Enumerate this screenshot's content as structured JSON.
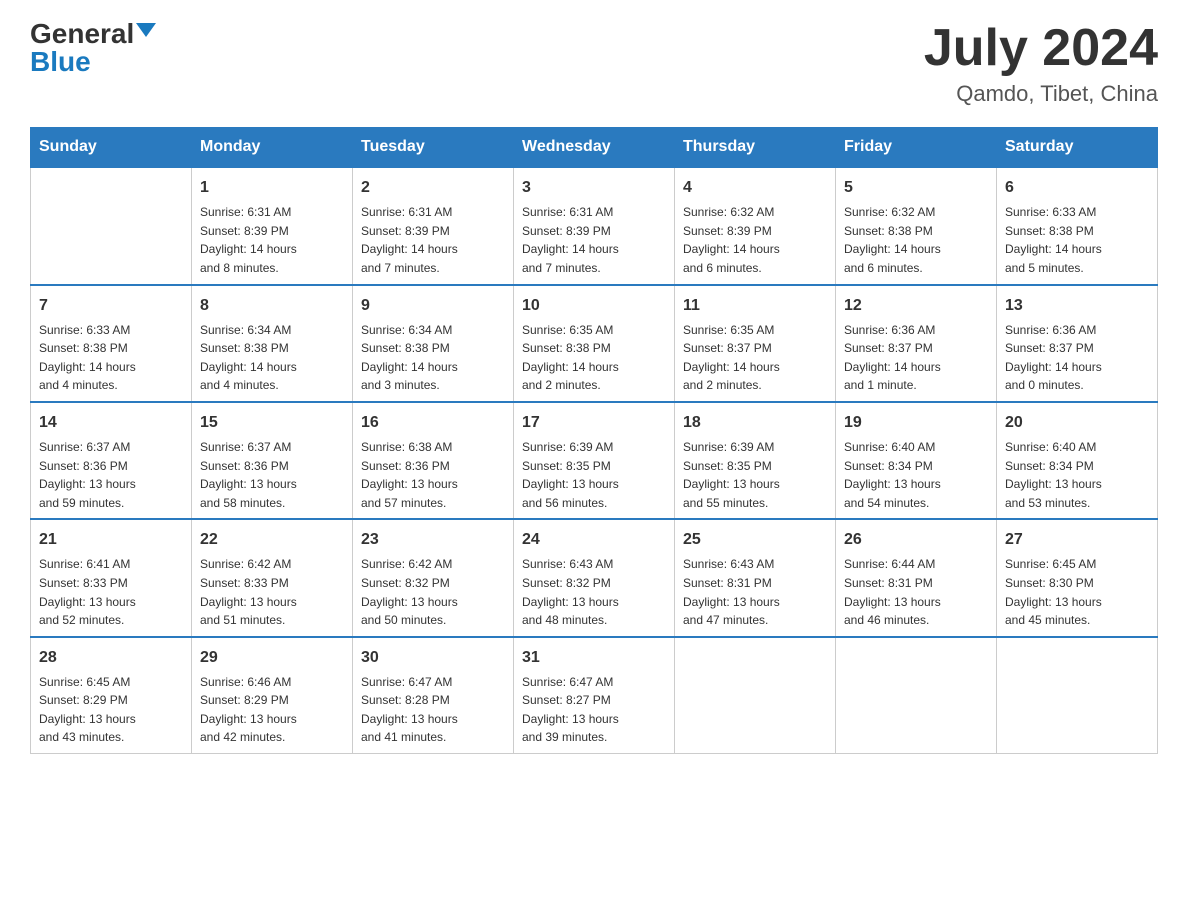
{
  "header": {
    "logo_general": "General",
    "logo_blue": "Blue",
    "month_year": "July 2024",
    "location": "Qamdo, Tibet, China"
  },
  "days_of_week": [
    "Sunday",
    "Monday",
    "Tuesday",
    "Wednesday",
    "Thursday",
    "Friday",
    "Saturday"
  ],
  "weeks": [
    [
      {
        "day": "",
        "info": ""
      },
      {
        "day": "1",
        "info": "Sunrise: 6:31 AM\nSunset: 8:39 PM\nDaylight: 14 hours\nand 8 minutes."
      },
      {
        "day": "2",
        "info": "Sunrise: 6:31 AM\nSunset: 8:39 PM\nDaylight: 14 hours\nand 7 minutes."
      },
      {
        "day": "3",
        "info": "Sunrise: 6:31 AM\nSunset: 8:39 PM\nDaylight: 14 hours\nand 7 minutes."
      },
      {
        "day": "4",
        "info": "Sunrise: 6:32 AM\nSunset: 8:39 PM\nDaylight: 14 hours\nand 6 minutes."
      },
      {
        "day": "5",
        "info": "Sunrise: 6:32 AM\nSunset: 8:38 PM\nDaylight: 14 hours\nand 6 minutes."
      },
      {
        "day": "6",
        "info": "Sunrise: 6:33 AM\nSunset: 8:38 PM\nDaylight: 14 hours\nand 5 minutes."
      }
    ],
    [
      {
        "day": "7",
        "info": "Sunrise: 6:33 AM\nSunset: 8:38 PM\nDaylight: 14 hours\nand 4 minutes."
      },
      {
        "day": "8",
        "info": "Sunrise: 6:34 AM\nSunset: 8:38 PM\nDaylight: 14 hours\nand 4 minutes."
      },
      {
        "day": "9",
        "info": "Sunrise: 6:34 AM\nSunset: 8:38 PM\nDaylight: 14 hours\nand 3 minutes."
      },
      {
        "day": "10",
        "info": "Sunrise: 6:35 AM\nSunset: 8:38 PM\nDaylight: 14 hours\nand 2 minutes."
      },
      {
        "day": "11",
        "info": "Sunrise: 6:35 AM\nSunset: 8:37 PM\nDaylight: 14 hours\nand 2 minutes."
      },
      {
        "day": "12",
        "info": "Sunrise: 6:36 AM\nSunset: 8:37 PM\nDaylight: 14 hours\nand 1 minute."
      },
      {
        "day": "13",
        "info": "Sunrise: 6:36 AM\nSunset: 8:37 PM\nDaylight: 14 hours\nand 0 minutes."
      }
    ],
    [
      {
        "day": "14",
        "info": "Sunrise: 6:37 AM\nSunset: 8:36 PM\nDaylight: 13 hours\nand 59 minutes."
      },
      {
        "day": "15",
        "info": "Sunrise: 6:37 AM\nSunset: 8:36 PM\nDaylight: 13 hours\nand 58 minutes."
      },
      {
        "day": "16",
        "info": "Sunrise: 6:38 AM\nSunset: 8:36 PM\nDaylight: 13 hours\nand 57 minutes."
      },
      {
        "day": "17",
        "info": "Sunrise: 6:39 AM\nSunset: 8:35 PM\nDaylight: 13 hours\nand 56 minutes."
      },
      {
        "day": "18",
        "info": "Sunrise: 6:39 AM\nSunset: 8:35 PM\nDaylight: 13 hours\nand 55 minutes."
      },
      {
        "day": "19",
        "info": "Sunrise: 6:40 AM\nSunset: 8:34 PM\nDaylight: 13 hours\nand 54 minutes."
      },
      {
        "day": "20",
        "info": "Sunrise: 6:40 AM\nSunset: 8:34 PM\nDaylight: 13 hours\nand 53 minutes."
      }
    ],
    [
      {
        "day": "21",
        "info": "Sunrise: 6:41 AM\nSunset: 8:33 PM\nDaylight: 13 hours\nand 52 minutes."
      },
      {
        "day": "22",
        "info": "Sunrise: 6:42 AM\nSunset: 8:33 PM\nDaylight: 13 hours\nand 51 minutes."
      },
      {
        "day": "23",
        "info": "Sunrise: 6:42 AM\nSunset: 8:32 PM\nDaylight: 13 hours\nand 50 minutes."
      },
      {
        "day": "24",
        "info": "Sunrise: 6:43 AM\nSunset: 8:32 PM\nDaylight: 13 hours\nand 48 minutes."
      },
      {
        "day": "25",
        "info": "Sunrise: 6:43 AM\nSunset: 8:31 PM\nDaylight: 13 hours\nand 47 minutes."
      },
      {
        "day": "26",
        "info": "Sunrise: 6:44 AM\nSunset: 8:31 PM\nDaylight: 13 hours\nand 46 minutes."
      },
      {
        "day": "27",
        "info": "Sunrise: 6:45 AM\nSunset: 8:30 PM\nDaylight: 13 hours\nand 45 minutes."
      }
    ],
    [
      {
        "day": "28",
        "info": "Sunrise: 6:45 AM\nSunset: 8:29 PM\nDaylight: 13 hours\nand 43 minutes."
      },
      {
        "day": "29",
        "info": "Sunrise: 6:46 AM\nSunset: 8:29 PM\nDaylight: 13 hours\nand 42 minutes."
      },
      {
        "day": "30",
        "info": "Sunrise: 6:47 AM\nSunset: 8:28 PM\nDaylight: 13 hours\nand 41 minutes."
      },
      {
        "day": "31",
        "info": "Sunrise: 6:47 AM\nSunset: 8:27 PM\nDaylight: 13 hours\nand 39 minutes."
      },
      {
        "day": "",
        "info": ""
      },
      {
        "day": "",
        "info": ""
      },
      {
        "day": "",
        "info": ""
      }
    ]
  ]
}
